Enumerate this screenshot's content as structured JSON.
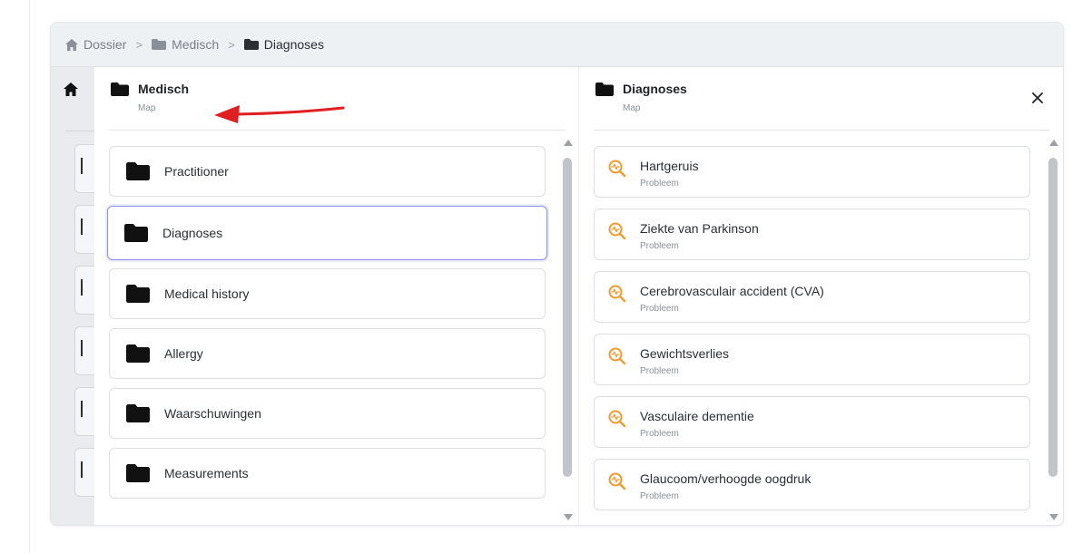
{
  "breadcrumb": {
    "items": [
      {
        "label": "Dossier",
        "icon": "home-icon"
      },
      {
        "label": "Medisch",
        "icon": "folder-icon"
      },
      {
        "label": "Diagnoses",
        "icon": "folder-icon"
      }
    ],
    "separator": ">"
  },
  "left_panel": {
    "title": "Medisch",
    "subtitle": "Map",
    "items": [
      {
        "label": "Practitioner"
      },
      {
        "label": "Diagnoses",
        "selected": true
      },
      {
        "label": "Medical history"
      },
      {
        "label": "Allergy"
      },
      {
        "label": "Waarschuwingen"
      },
      {
        "label": "Measurements"
      }
    ]
  },
  "right_panel": {
    "title": "Diagnoses",
    "subtitle": "Map",
    "close_icon": "close-icon",
    "items": [
      {
        "label": "Hartgeruis",
        "sub": "Probleem"
      },
      {
        "label": "Ziekte van Parkinson",
        "sub": "Probleem"
      },
      {
        "label": "Cerebrovasculair accident (CVA)",
        "sub": "Probleem"
      },
      {
        "label": "Gewichtsverlies",
        "sub": "Probleem"
      },
      {
        "label": "Vasculaire dementie",
        "sub": "Probleem"
      },
      {
        "label": "Glaucoom/verhoogde oogdruk",
        "sub": "Probleem"
      }
    ]
  },
  "colors": {
    "accent_selected": "#8c93e3",
    "problem_icon": "#f29a2e",
    "annotation_arrow": "#e02020"
  }
}
